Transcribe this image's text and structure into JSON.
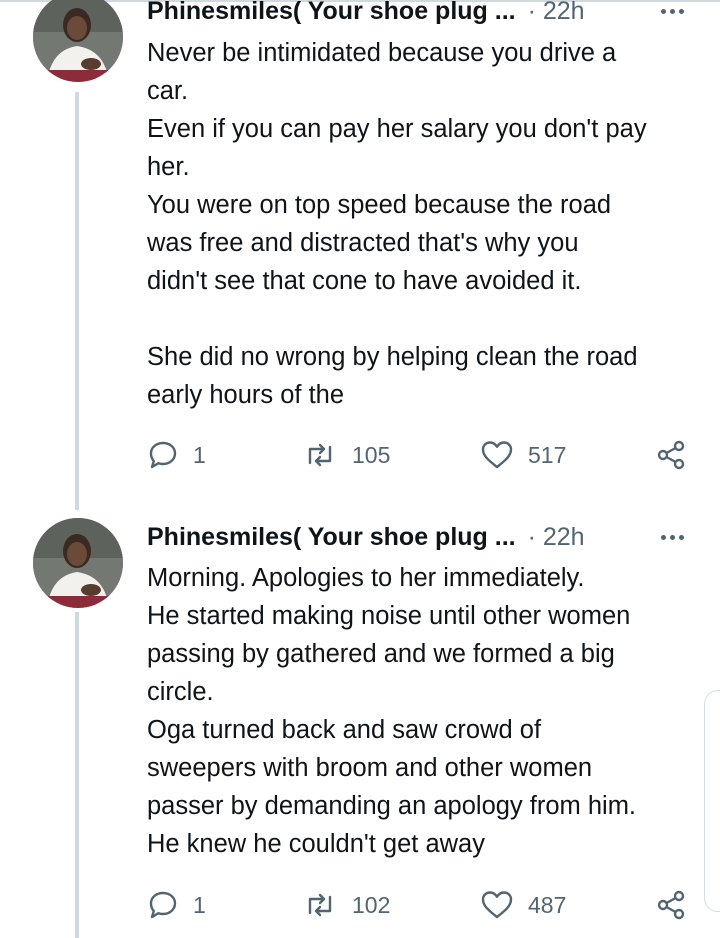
{
  "tweets": [
    {
      "author": "Phinesmiles( Your shoe plug ...",
      "time": "· 22h",
      "lines": [
        "Never be intimidated because you drive a",
        "car.",
        "Even if you can pay her salary you don't pay",
        "her.",
        "You were on top speed because the road",
        "was free and distracted that's why you",
        "didn't see that cone to have avoided it.",
        "",
        "She did no wrong by helping clean the road",
        "early hours of the"
      ],
      "replies": "1",
      "retweets": "105",
      "likes": "517"
    },
    {
      "author": "Phinesmiles( Your shoe plug ...",
      "time": "· 22h",
      "lines": [
        "Morning. Apologies to her immediately.",
        "He started making noise until other women",
        "passing by gathered and we formed a big",
        "circle.",
        "Oga turned back and saw crowd of",
        "sweepers with broom and other women",
        "passer by demanding an apology from him.",
        "He knew he couldn't get away"
      ],
      "replies": "1",
      "retweets": "102",
      "likes": "487"
    }
  ],
  "icons": {
    "reply": "reply-icon",
    "retweet": "retweet-icon",
    "like": "heart-icon",
    "share": "share-icon",
    "more": "more-icon"
  },
  "colors": {
    "text": "#0f1419",
    "muted": "#536471",
    "thread_line": "#cfd9de"
  }
}
